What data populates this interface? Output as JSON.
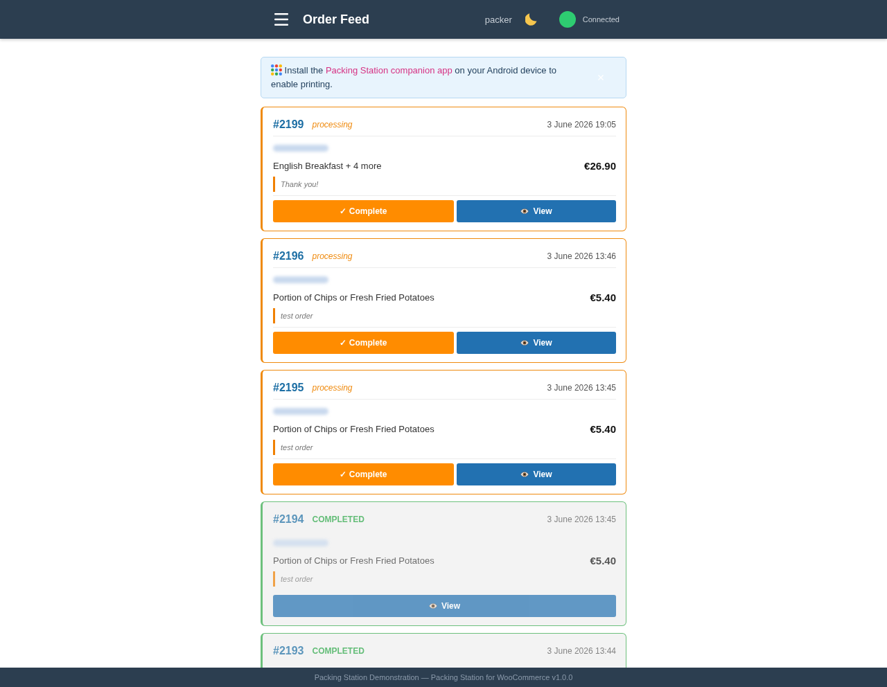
{
  "header": {
    "title": "Order Feed",
    "user": "packer",
    "connection": {
      "label": "Connected",
      "connected": true
    }
  },
  "banner": {
    "text_before": "Install the",
    "link": "Packing Station companion app",
    "text_after": "on your Android device to enable printing."
  },
  "orders": [
    {
      "kind": "processing",
      "number": "#2199",
      "status": "processing",
      "date": "3 June 2026 19:05",
      "items": "English Breakfast + 4 more",
      "total": "€26.90",
      "note": "Thank you!",
      "actions": [
        {
          "kind": "complete",
          "label": "✓ Complete"
        },
        {
          "kind": "view",
          "label": "View"
        }
      ]
    },
    {
      "kind": "processing",
      "number": "#2196",
      "status": "processing",
      "date": "3 June 2026 13:46",
      "items": "Portion of Chips or Fresh Fried Potatoes",
      "total": "€5.40",
      "note": "test order",
      "actions": [
        {
          "kind": "complete",
          "label": "✓ Complete"
        },
        {
          "kind": "view",
          "label": "View"
        }
      ]
    },
    {
      "kind": "processing",
      "number": "#2195",
      "status": "processing",
      "date": "3 June 2026 13:45",
      "items": "Portion of Chips or Fresh Fried Potatoes",
      "total": "€5.40",
      "note": "test order",
      "actions": [
        {
          "kind": "complete",
          "label": "✓ Complete"
        },
        {
          "kind": "view",
          "label": "View"
        }
      ]
    },
    {
      "kind": "completed",
      "number": "#2194",
      "status": "COMPLETED",
      "date": "3 June 2026 13:45",
      "items": "Portion of Chips or Fresh Fried Potatoes",
      "total": "€5.40",
      "note": "test order",
      "actions": [
        {
          "kind": "view",
          "label": "View"
        }
      ]
    },
    {
      "kind": "completed",
      "number": "#2193",
      "status": "COMPLETED",
      "date": "3 June 2026 13:44"
    }
  ],
  "footer": "Packing Station Demonstration — Packing Station for WooCommerce v1.0.0"
}
